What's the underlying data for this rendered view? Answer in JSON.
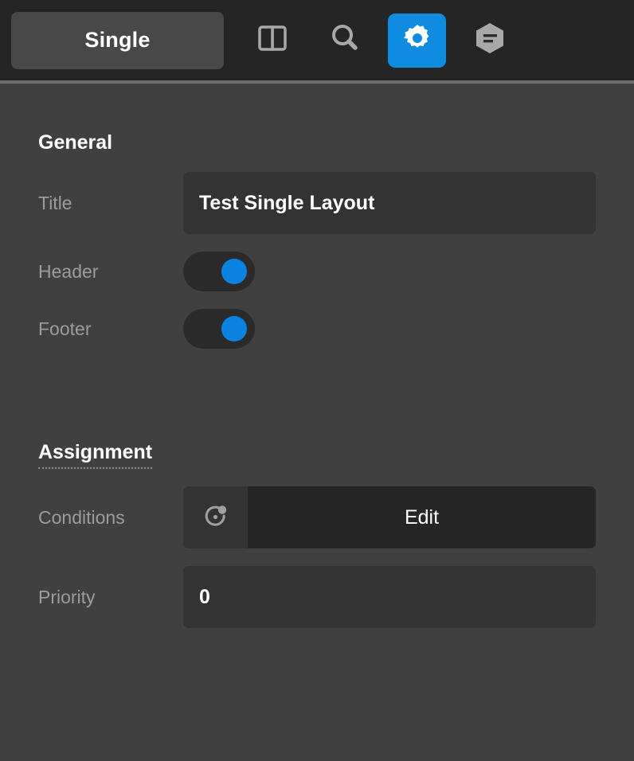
{
  "toolbar": {
    "mode_label": "Single",
    "icons": [
      {
        "name": "split-layout-icon",
        "label": "Split Layout",
        "active": false
      },
      {
        "name": "search-icon",
        "label": "Search",
        "active": false
      },
      {
        "name": "gear-icon",
        "label": "Settings",
        "active": true
      },
      {
        "name": "hexagon-list-icon",
        "label": "Notes",
        "active": false
      }
    ],
    "accent_color": "#0f8ce0"
  },
  "general": {
    "heading": "General",
    "title": {
      "label": "Title",
      "value": "Test Single Layout",
      "placeholder": ""
    },
    "header": {
      "label": "Header",
      "value": "on"
    },
    "footer": {
      "label": "Footer",
      "value": "on"
    }
  },
  "assignment": {
    "heading": "Assignment",
    "conditions": {
      "label": "Conditions",
      "icon": "conditions-icon",
      "button_label": "Edit"
    },
    "priority": {
      "label": "Priority",
      "value": "0",
      "placeholder": ""
    }
  }
}
